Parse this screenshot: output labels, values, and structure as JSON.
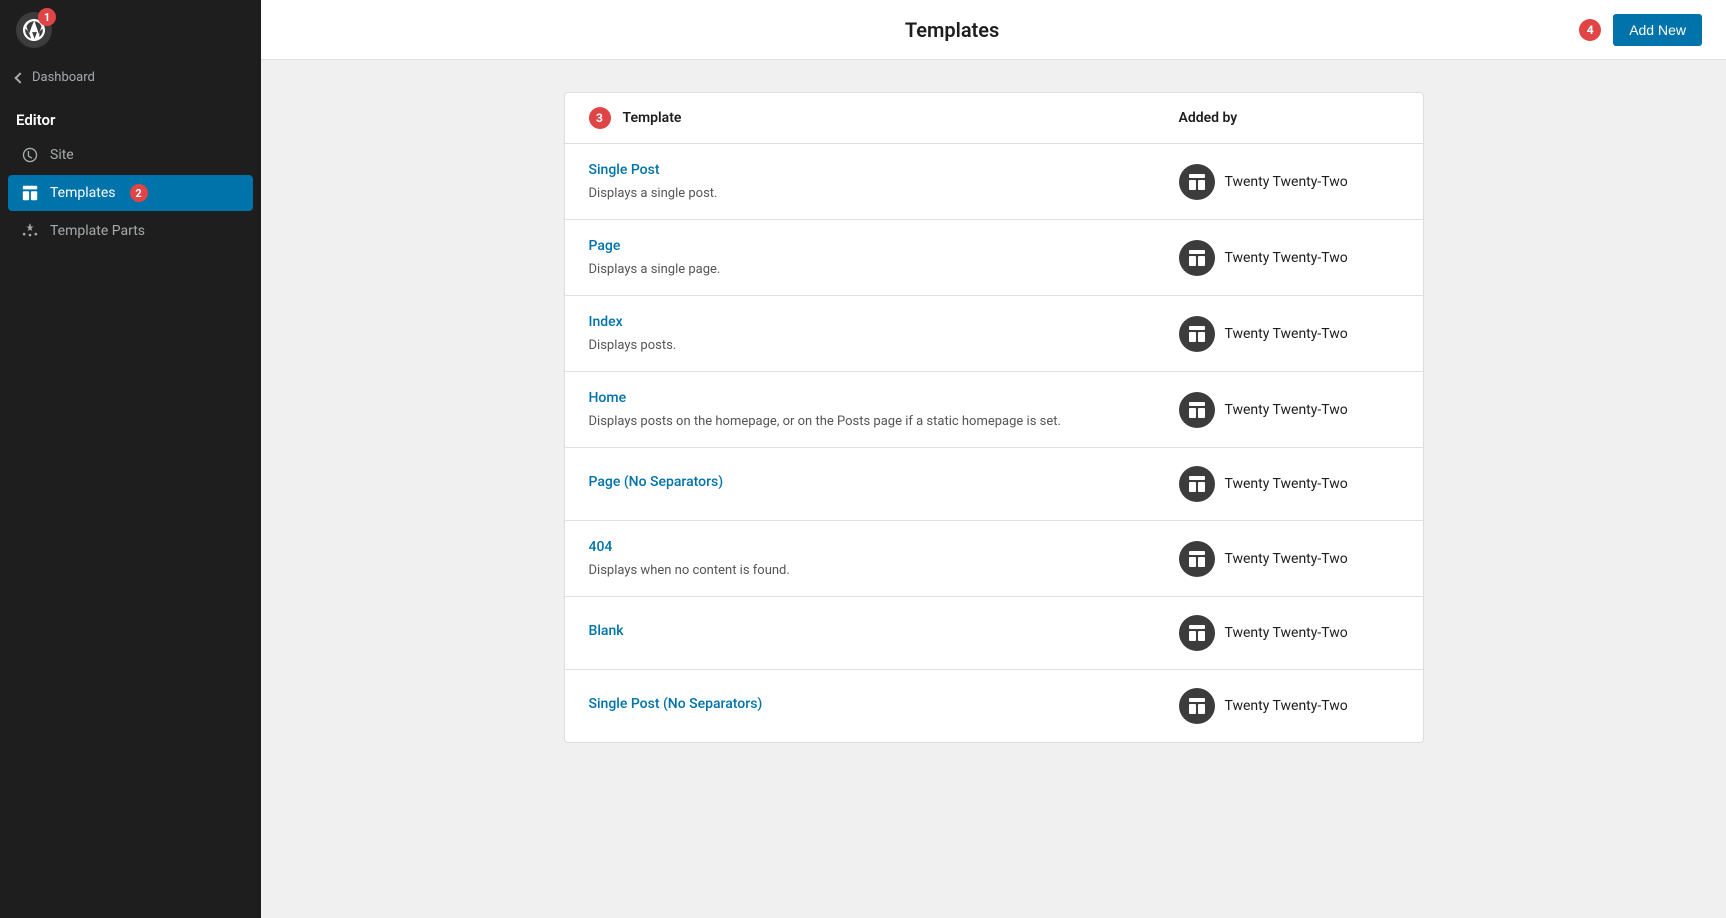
{
  "sidebar": {
    "wp_badge": "1",
    "dashboard_label": "Dashboard",
    "editor_title": "Editor",
    "nav_items": [
      {
        "id": "site",
        "label": "Site",
        "icon": "site-icon"
      },
      {
        "id": "templates",
        "label": "Templates",
        "icon": "templates-icon",
        "active": true,
        "badge": "2"
      },
      {
        "id": "template-parts",
        "label": "Template Parts",
        "icon": "parts-icon"
      }
    ]
  },
  "header": {
    "title": "Templates",
    "badge": "4",
    "add_new_label": "Add New"
  },
  "table": {
    "badge": "3",
    "col_template": "Template",
    "col_added": "Added by",
    "rows": [
      {
        "name": "Single Post",
        "desc": "Displays a single post.",
        "added_by": "Twenty Twenty-Two"
      },
      {
        "name": "Page",
        "desc": "Displays a single page.",
        "added_by": "Twenty Twenty-Two"
      },
      {
        "name": "Index",
        "desc": "Displays posts.",
        "added_by": "Twenty Twenty-Two"
      },
      {
        "name": "Home",
        "desc": "Displays posts on the homepage, or on the Posts page if a static homepage is set.",
        "added_by": "Twenty Twenty-Two"
      },
      {
        "name": "Page (No Separators)",
        "desc": "",
        "added_by": "Twenty Twenty-Two"
      },
      {
        "name": "404",
        "desc": "Displays when no content is found.",
        "added_by": "Twenty Twenty-Two"
      },
      {
        "name": "Blank",
        "desc": "",
        "added_by": "Twenty Twenty-Two"
      },
      {
        "name": "Single Post (No Separators)",
        "desc": "",
        "added_by": "Twenty Twenty-Two"
      }
    ]
  },
  "colors": {
    "accent": "#0073aa",
    "badge_red": "#e04444",
    "sidebar_bg": "#1e1e1e",
    "active_nav": "#0073aa"
  }
}
